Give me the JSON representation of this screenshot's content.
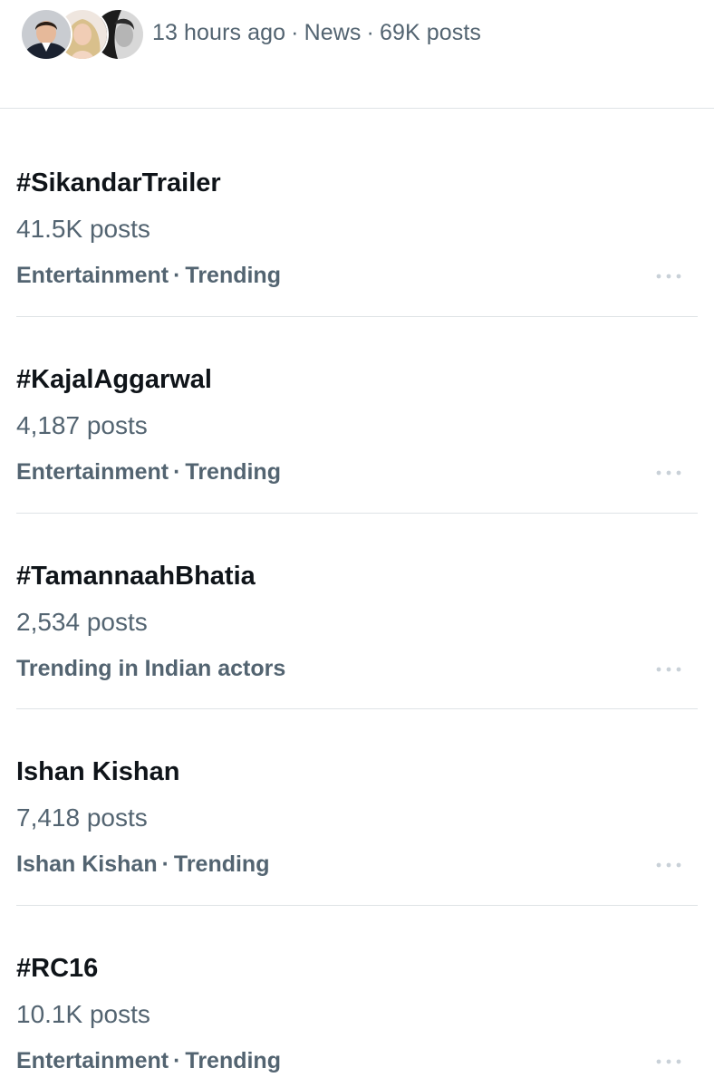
{
  "header": {
    "time": "13 hours ago",
    "separator": "·",
    "category": "News",
    "count": "69K posts",
    "avatars": [
      "man-avatar",
      "woman-avatar",
      "monochrome-avatar"
    ]
  },
  "trends": [
    {
      "title": "#SikandarTrailer",
      "posts": "41.5K posts",
      "context": "Entertainment",
      "status": "Trending",
      "more_icon": "more-horizontal-icon"
    },
    {
      "title": "#KajalAggarwal",
      "posts": "4,187 posts",
      "context": "Entertainment",
      "status": "Trending",
      "more_icon": "more-horizontal-icon"
    },
    {
      "title": "#TamannaahBhatia",
      "posts": "2,534 posts",
      "context": "Trending in Indian actors",
      "status": "",
      "more_icon": "more-horizontal-icon"
    },
    {
      "title": "Ishan Kishan",
      "posts": "7,418 posts",
      "context": "Ishan Kishan",
      "status": "Trending",
      "more_icon": "more-horizontal-icon"
    },
    {
      "title": "#RC16",
      "posts": "10.1K posts",
      "context": "Entertainment",
      "status": "Trending",
      "more_icon": "more-horizontal-icon"
    }
  ],
  "colors": {
    "primary_text": "#0f1419",
    "secondary_text": "#536471",
    "divider": "#dfe3e6",
    "more_dots": "#c9d1d8"
  }
}
